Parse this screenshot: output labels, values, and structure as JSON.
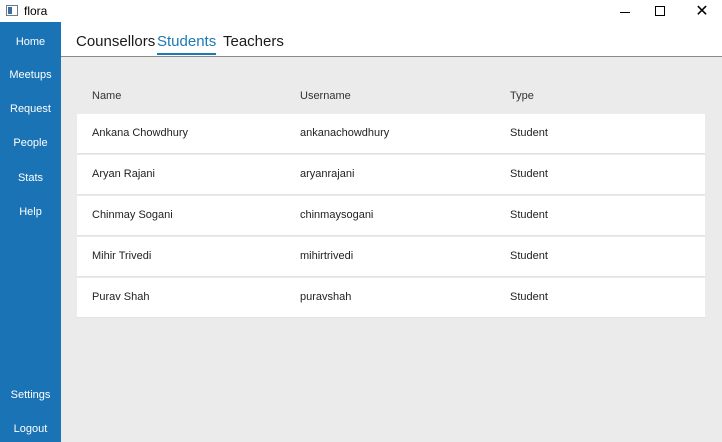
{
  "window": {
    "title": "flora",
    "minimize": "–",
    "maximize": "",
    "close": "✕"
  },
  "sidebar": {
    "items": [
      {
        "label": "Home"
      },
      {
        "label": "Meetups"
      },
      {
        "label": "Request"
      },
      {
        "label": "People"
      },
      {
        "label": "Stats"
      },
      {
        "label": "Help"
      }
    ],
    "bottom": [
      {
        "label": "Settings"
      },
      {
        "label": "Logout"
      }
    ]
  },
  "tabs": [
    {
      "label": "Counsellors",
      "active": false
    },
    {
      "label": "Students",
      "active": true
    },
    {
      "label": "Teachers",
      "active": false
    }
  ],
  "table": {
    "columns": [
      "Name",
      "Username",
      "Type"
    ],
    "rows": [
      [
        "Ankana Chowdhury",
        "ankanachowdhury",
        "Student"
      ],
      [
        "Aryan Rajani",
        "aryanrajani",
        "Student"
      ],
      [
        "Chinmay Sogani",
        "chinmaysogani",
        "Student"
      ],
      [
        "Mihir Trivedi",
        "mihirtrivedi",
        "Student"
      ],
      [
        "Purav Shah",
        "puravshah",
        "Student"
      ]
    ]
  },
  "colors": {
    "sidebar": "#1a73b5",
    "accent": "#1a7ab5",
    "content_bg": "#ebebeb"
  }
}
